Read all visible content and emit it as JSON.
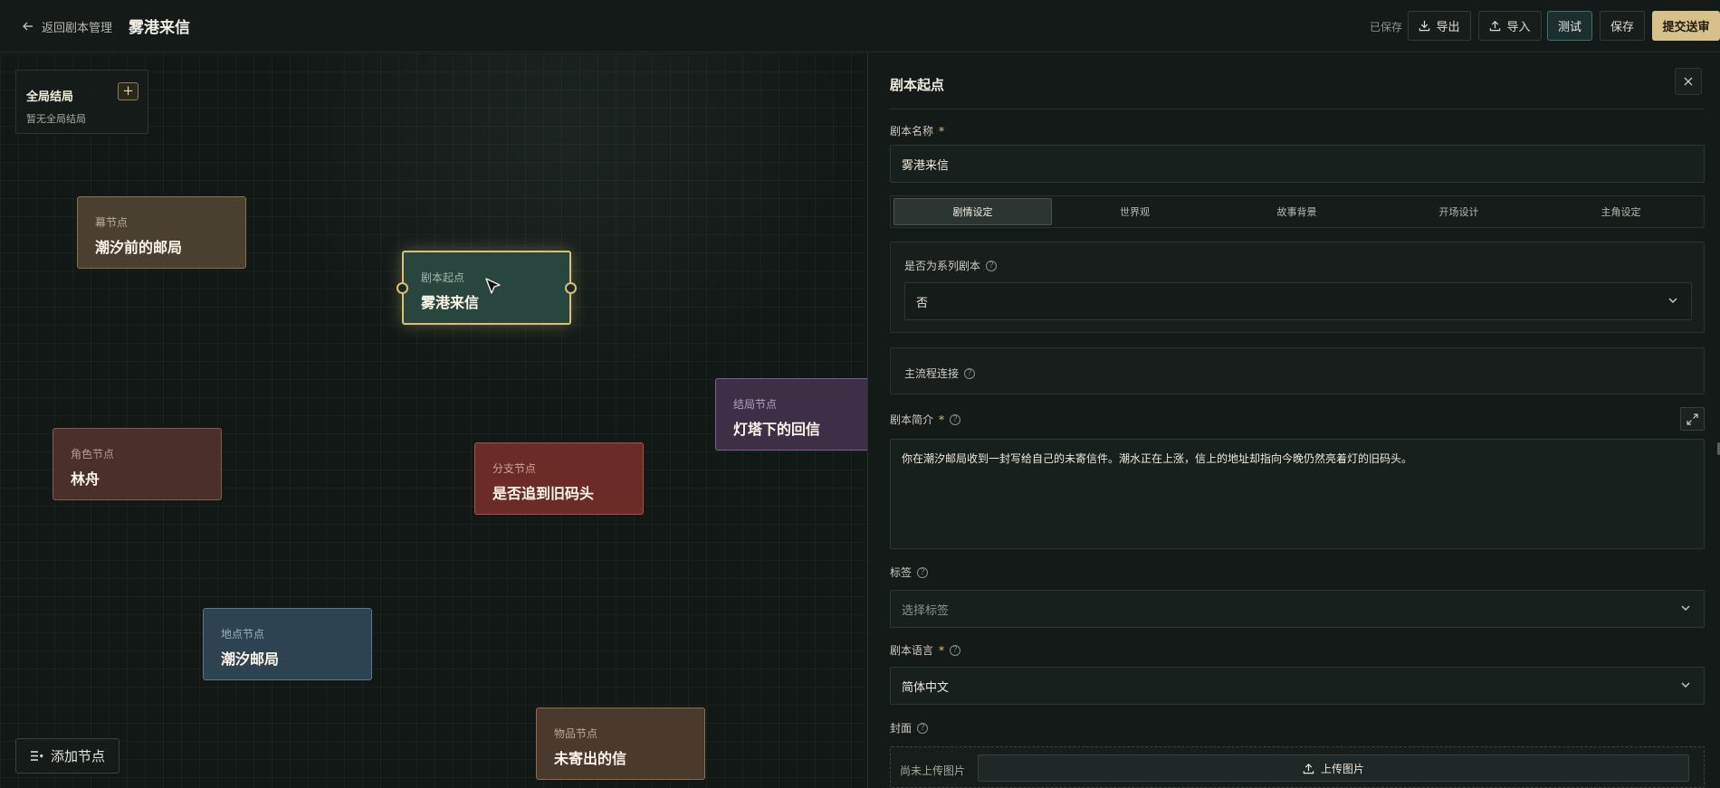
{
  "header": {
    "back_label": "返回剧本管理",
    "title": "雾港来信",
    "saved_status": "已保存",
    "export_label": "导出",
    "import_label": "导入",
    "test_label": "测试",
    "save_label": "保存",
    "submit_label": "提交送审"
  },
  "canvas": {
    "global_panel": {
      "title": "全局结局",
      "add_label": "+",
      "empty_text": "暂无全局结局"
    },
    "nodes": [
      {
        "type": "幕节点",
        "name": "潮汐前的邮局"
      },
      {
        "type": "剧本起点",
        "name": "雾港来信"
      },
      {
        "type": "结局节点",
        "name": "灯塔下的回信"
      },
      {
        "type": "角色节点",
        "name": "林舟"
      },
      {
        "type": "分支节点",
        "name": "是否追到旧码头"
      },
      {
        "type": "地点节点",
        "name": "潮汐邮局"
      },
      {
        "type": "物品节点",
        "name": "未寄出的信"
      }
    ],
    "add_node_label": "添加节点"
  },
  "panel": {
    "title": "剧本起点",
    "close_icon": "×",
    "name_label": "剧本名称",
    "name_value": "雾港来信",
    "required_mark": "*",
    "help_mark": "?",
    "tabs": [
      {
        "label": "剧情设定",
        "active": true
      },
      {
        "label": "世界观",
        "active": false
      },
      {
        "label": "故事背景",
        "active": false
      },
      {
        "label": "开场设计",
        "active": false
      },
      {
        "label": "主角设定",
        "active": false
      }
    ],
    "series_label": "是否为系列剧本",
    "series_value": "否",
    "mainflow_label": "主流程连接",
    "summary_label": "剧本简介",
    "summary_value": "你在潮汐邮局收到一封写给自己的未寄信件。潮水正在上涨，信上的地址却指向今晚仍然亮着灯的旧码头。",
    "tags_label": "标签",
    "tags_placeholder": "选择标签",
    "language_label": "剧本语言",
    "language_value": "简体中文",
    "cover_label": "封面",
    "cover_empty": "尚未上传图片",
    "upload_label": "上传图片"
  },
  "colors": {
    "accent_gold": "#d8c08a",
    "test_teal": "#1b2f2e",
    "start_node_border": "#d6c175"
  }
}
